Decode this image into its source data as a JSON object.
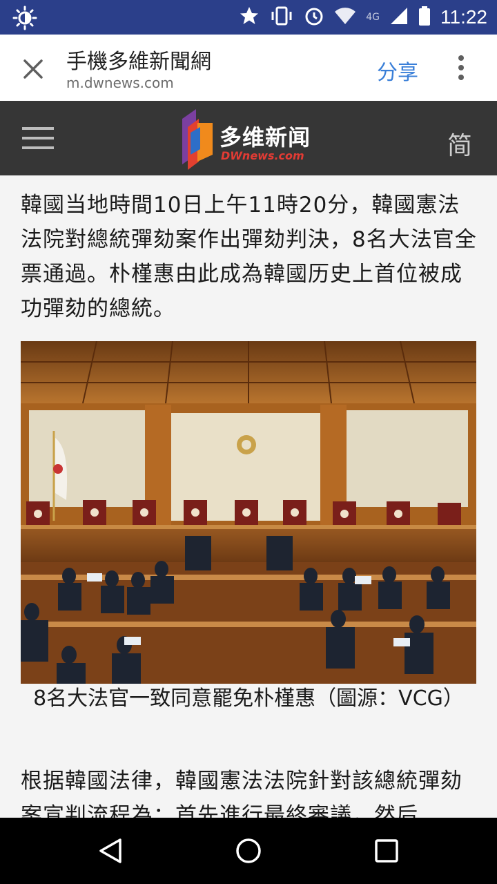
{
  "status_bar": {
    "time": "11:22",
    "network": "4G",
    "icons": [
      "brightness-icon",
      "star-icon",
      "vibrate-icon",
      "alarm-icon",
      "wifi-icon",
      "signal-icon",
      "battery-icon"
    ]
  },
  "toolbar": {
    "title": "手機多維新聞網",
    "url": "m.dwnews.com",
    "share_label": "分享"
  },
  "site_header": {
    "logo_cn": "多维新闻",
    "logo_en": "DWnews.com",
    "lang_toggle": "简"
  },
  "article": {
    "para1": "韓國当地時間10日上午11時20分，韓國憲法法院對總統彈劾案作出彈劾判決，8名大法官全票通過。朴槿惠由此成為韓國历史上首位被成功彈劾的總統。",
    "caption": "8名大法官一致同意罷免朴槿惠（圖源：VCG）",
    "para2": "根据韓國法律，韓國憲法法院針對該總統彈劾案宣判流程為：首先進行最終審議，然后"
  },
  "colors": {
    "status_bar": "#2b3f8a",
    "site_header": "#363636",
    "accent_blue": "#3a7fd8",
    "logo_red": "#e23b34"
  }
}
